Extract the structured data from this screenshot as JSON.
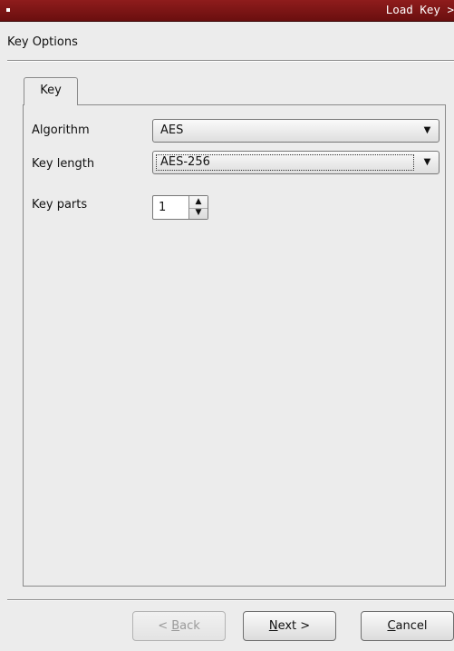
{
  "window": {
    "title": "Load Key >",
    "icon": "window-menu-icon"
  },
  "page": {
    "heading": "Key Options"
  },
  "tabs": [
    {
      "label": "Key",
      "selected": true
    }
  ],
  "form": {
    "algorithm": {
      "label": "Algorithm",
      "value": "AES"
    },
    "key_length": {
      "label": "Key length",
      "value": "AES-256"
    },
    "key_parts": {
      "label": "Key parts",
      "value": "1"
    }
  },
  "icons": {
    "dropdown": "▼",
    "spin_up": "▲",
    "spin_down": "▼"
  },
  "footer": {
    "back": {
      "mnemonic_before": "< ",
      "mnemonic": "B",
      "rest": "ack",
      "enabled": false
    },
    "next": {
      "mnemonic": "N",
      "rest": "ext >"
    },
    "cancel": {
      "mnemonic": "C",
      "rest": "ancel"
    }
  },
  "colors": {
    "titlebar": "#7b1515",
    "background": "#ececec"
  }
}
